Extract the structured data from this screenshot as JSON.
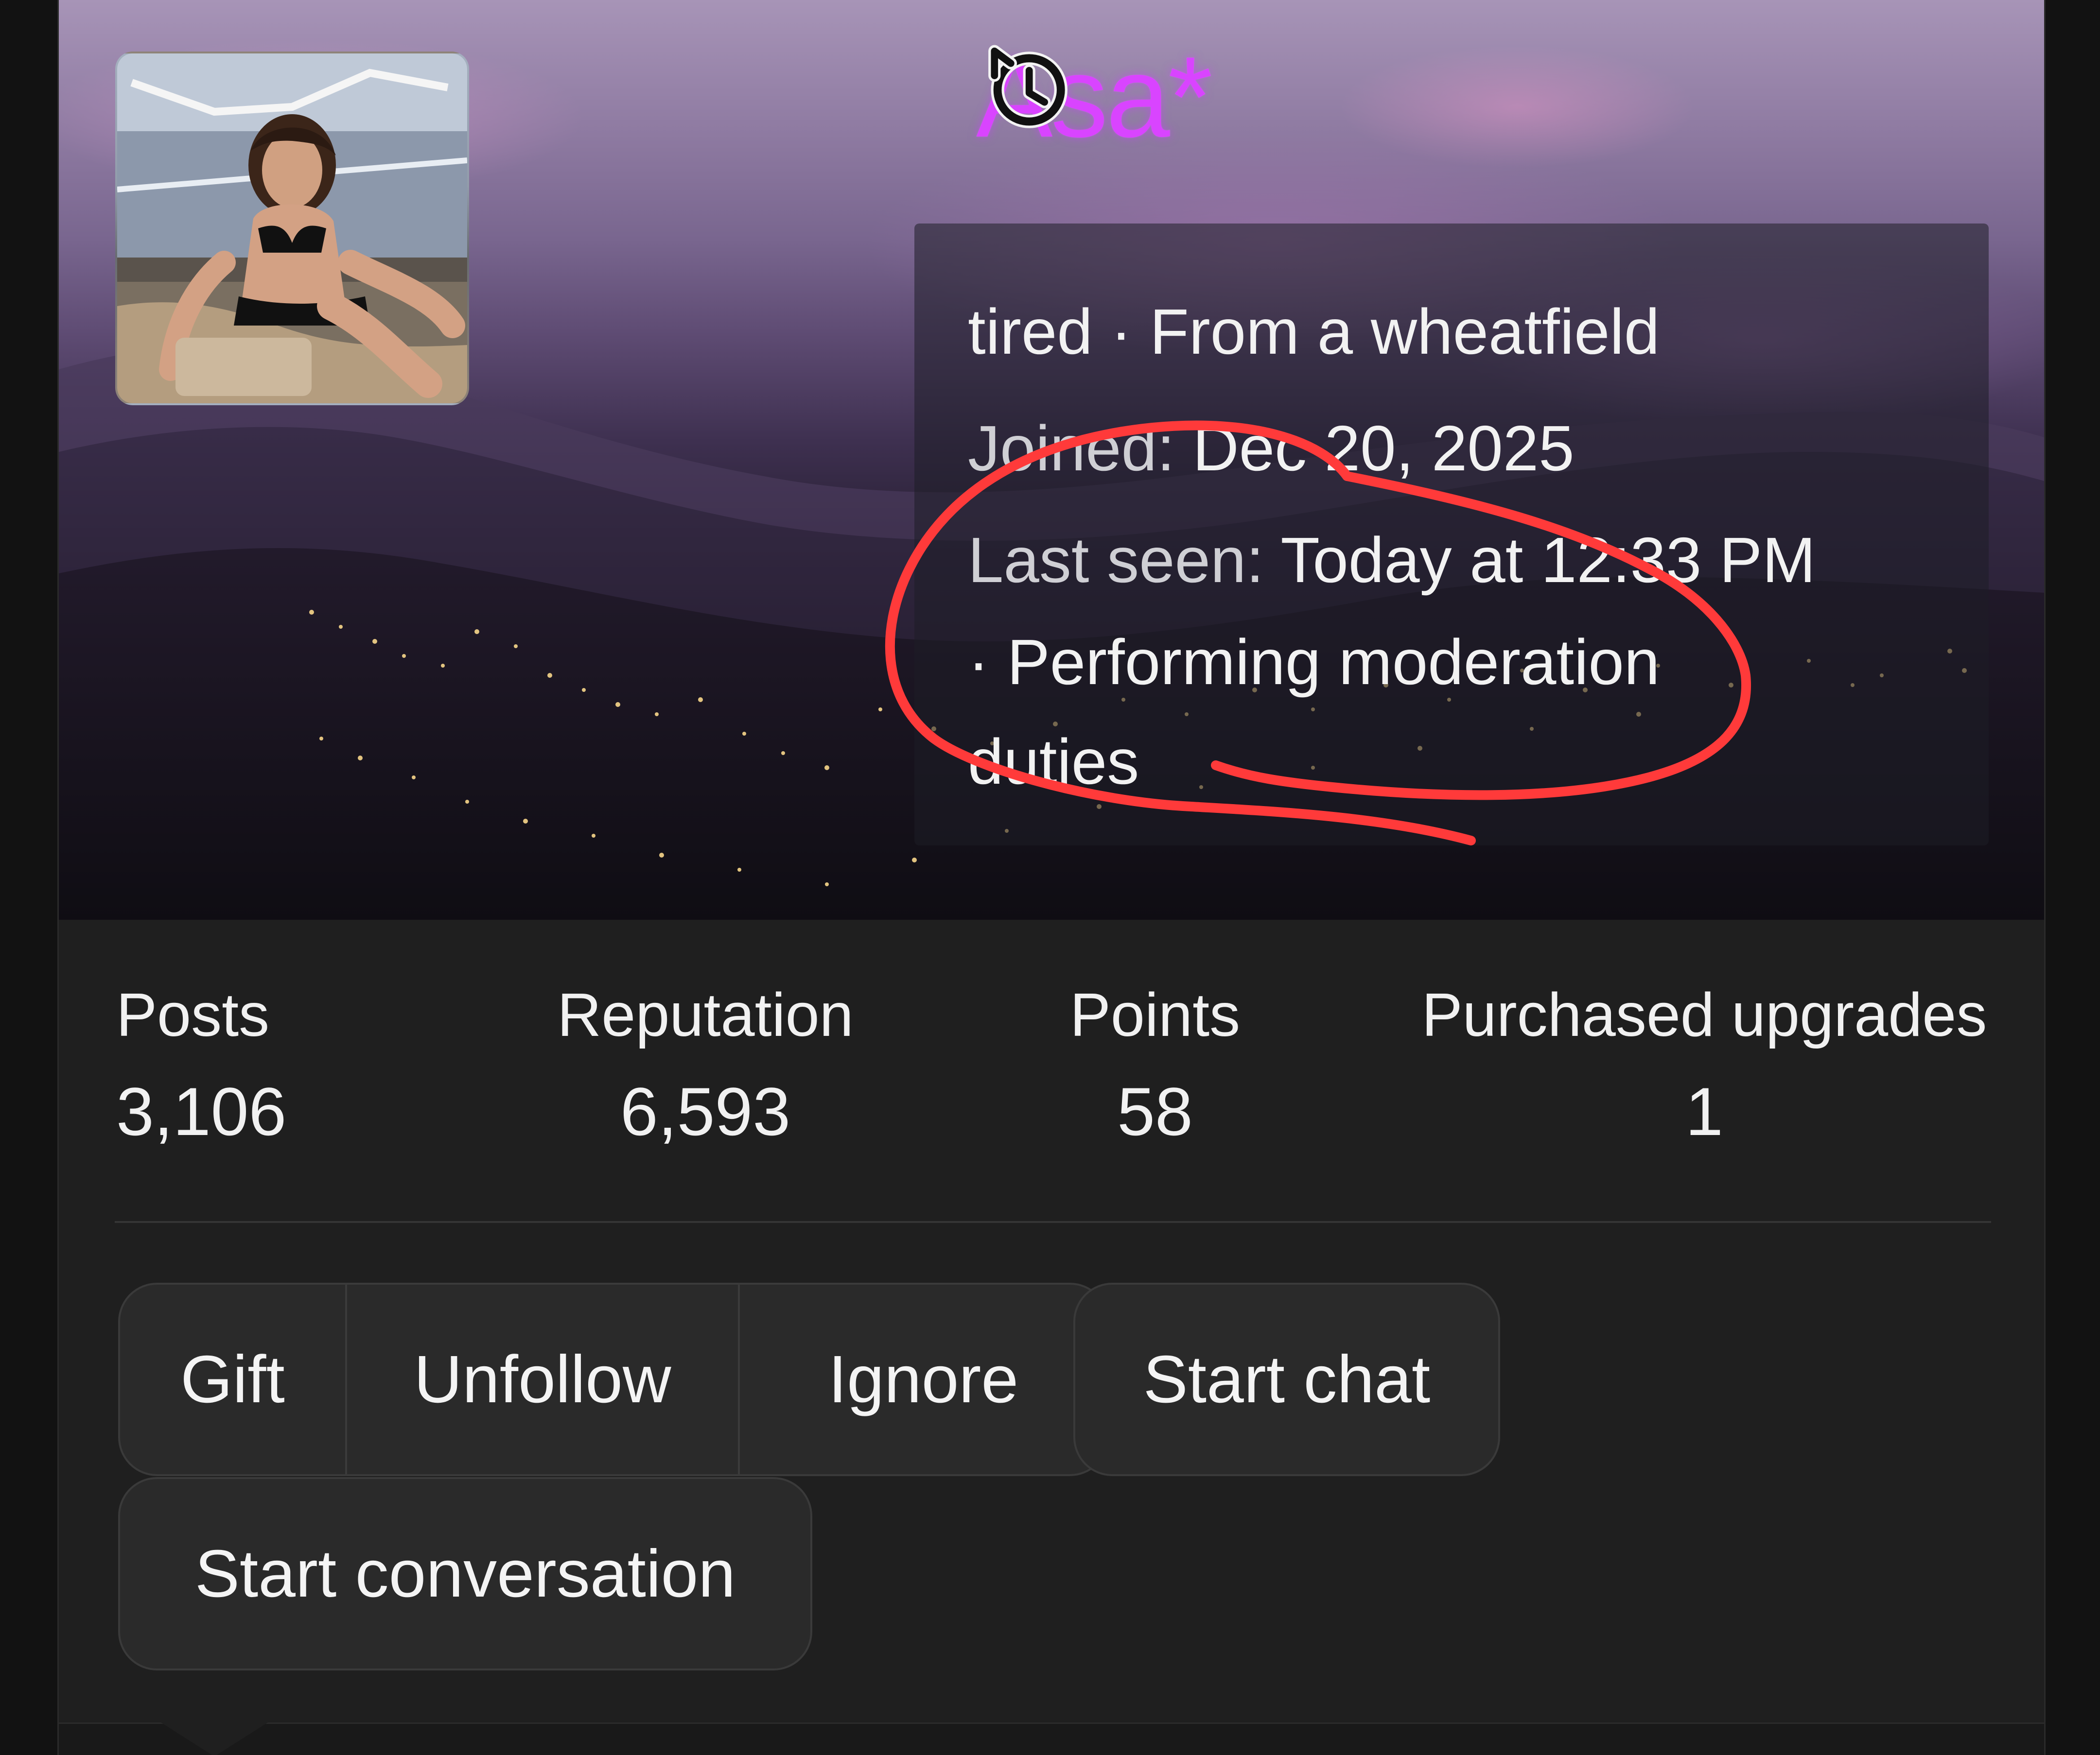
{
  "profile": {
    "username": "Asa*",
    "status": "tired",
    "location": "From a wheatfield",
    "status_separator": "·",
    "joined_label": "Joined:",
    "joined_value": "Dec 20, 2025",
    "last_seen_label": "Last seen:",
    "last_seen_value": "Today at 12:33 PM",
    "activity_prefix": "·",
    "activity_line_1": "Performing moderation",
    "activity_line_2": "duties"
  },
  "stats": {
    "posts_label": "Posts",
    "posts_value": "3,106",
    "reputation_label": "Reputation",
    "reputation_value": "6,593",
    "points_label": "Points",
    "points_value": "58",
    "upgrades_label": "Purchased upgrades",
    "upgrades_value": "1"
  },
  "actions": {
    "gift": "Gift",
    "unfollow": "Unfollow",
    "ignore": "Ignore",
    "start_chat": "Start chat",
    "start_conversation": "Start conversation"
  },
  "icons": {
    "history": "history-icon"
  },
  "colors": {
    "username": "#d944ff",
    "annotation": "#ff3a3a",
    "card_background": "#1f1f1f"
  }
}
